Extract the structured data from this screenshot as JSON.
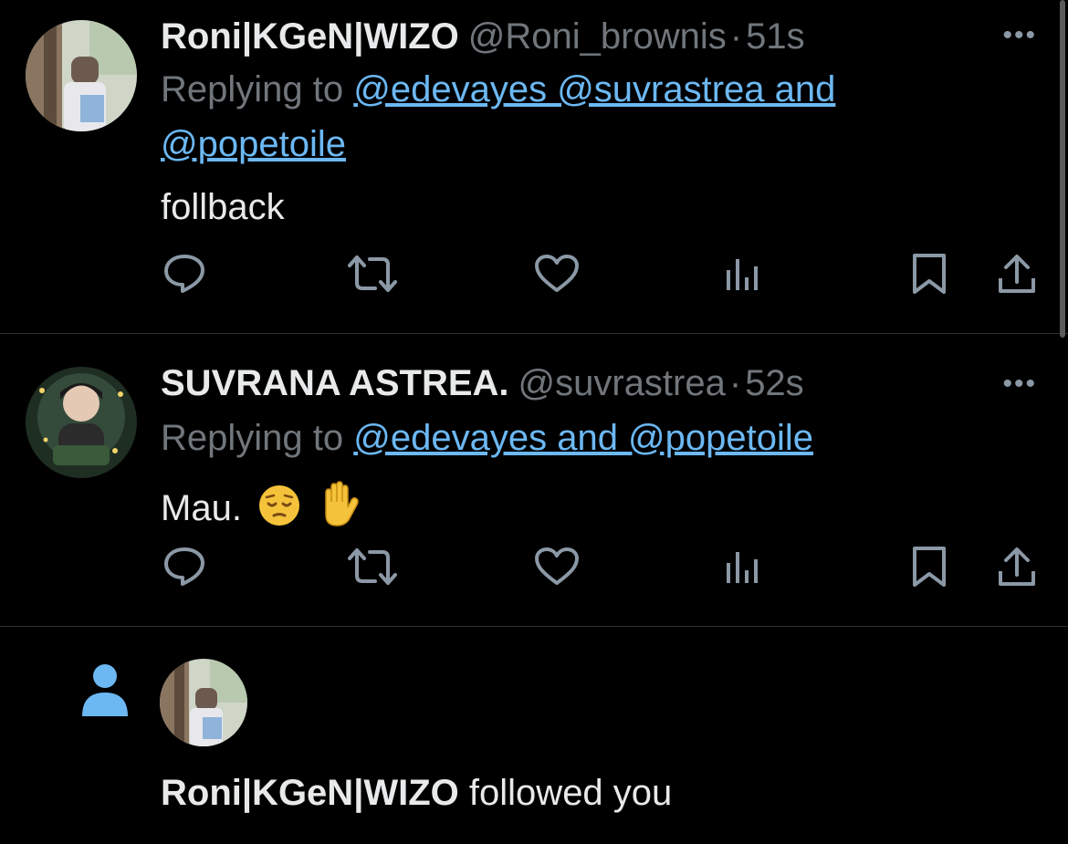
{
  "tweets": [
    {
      "name": "Roni|KGeN|WIZO",
      "handle": "@Roni_brownis",
      "separator": "·",
      "time": "51s",
      "replying_prefix": "Replying to",
      "mentions_line1": "@edevayes @suvrastrea and",
      "mentions_line2": "@popetoile",
      "text": "follback"
    },
    {
      "name": "SUVRANA ASTREA.",
      "handle": "@suvrastrea",
      "separator": "·",
      "time": "52s",
      "replying_prefix": "Replying to",
      "mentions_line1": "@edevayes and @popetoile",
      "text": "Mau.",
      "emojis": [
        "pensive-face",
        "raised-hand"
      ]
    }
  ],
  "more_label": "•••",
  "notification": {
    "name": "Roni|KGeN|WIZO",
    "action": "followed you"
  },
  "colors": {
    "background": "#000000",
    "text": "#e7e9ea",
    "muted": "#71767b",
    "link": "#6cb8f3",
    "icon": "#8b98a5",
    "follow_icon": "#6cb8f3"
  }
}
